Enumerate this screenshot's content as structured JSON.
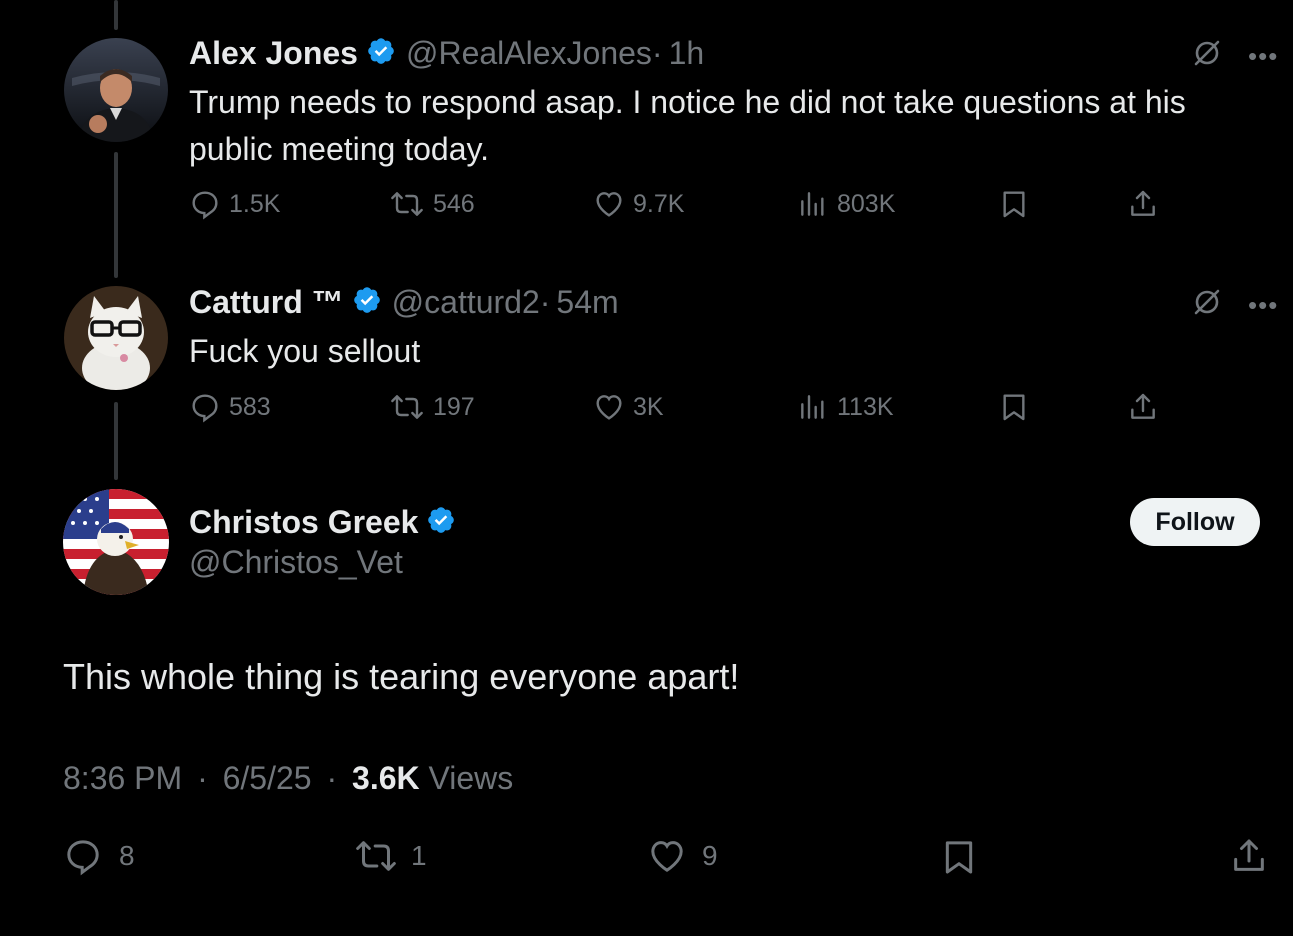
{
  "tweets": [
    {
      "name": "Alex Jones",
      "handle": "@RealAlexJones",
      "time": "1h",
      "text": "Trump needs to respond asap. I notice he did not take questions at his public meeting today.",
      "replies": "1.5K",
      "reposts": "546",
      "likes": "9.7K",
      "views": "803K"
    },
    {
      "name": "Catturd ™",
      "handle": "@catturd2",
      "time": "54m",
      "text": "Fuck you sellout",
      "replies": "583",
      "reposts": "197",
      "likes": "3K",
      "views": "113K"
    }
  ],
  "main_tweet": {
    "name": "Christos Greek",
    "handle": "@Christos_Vet",
    "follow_label": "Follow",
    "text": "This whole thing is tearing everyone apart!",
    "time": "8:36 PM",
    "date": "6/5/25",
    "views_count": "3.6K",
    "views_label": "Views",
    "replies": "8",
    "reposts": "1",
    "likes": "9"
  },
  "separator": "·",
  "colors": {
    "background": "#000000",
    "text_primary": "#e7e9ea",
    "text_secondary": "#71767b",
    "verified_blue": "#1d9bf0",
    "thread_line": "#333639",
    "follow_bg": "#eff3f4"
  },
  "icons": [
    "verified-badge-icon",
    "grok-icon",
    "more-icon",
    "reply-icon",
    "repost-icon",
    "like-icon",
    "views-icon",
    "bookmark-icon",
    "share-icon"
  ]
}
